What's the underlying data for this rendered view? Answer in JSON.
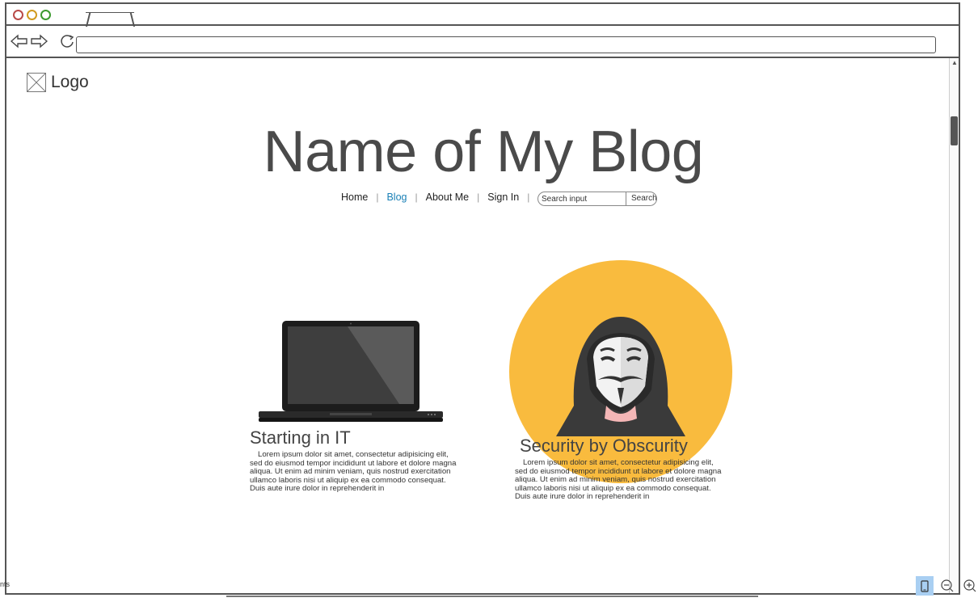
{
  "browser": {
    "url": ""
  },
  "page": {
    "logo_label": "Logo",
    "blog_title": "Name of My Blog",
    "nav": [
      {
        "label": "Home",
        "active": false
      },
      {
        "label": "Blog",
        "active": true
      },
      {
        "label": "About Me",
        "active": false
      },
      {
        "label": "Sign In",
        "active": false
      }
    ],
    "search": {
      "placeholder": "Search input",
      "button_label": "Search"
    },
    "posts": [
      {
        "title": "Starting in IT",
        "image_icon": "laptop-icon",
        "body": "Lorem ipsum dolor sit amet, consectetur adipisicing elit, sed do eiusmod tempor incididunt ut labore et dolore magna aliqua. Ut enim ad minim veniam, quis nostrud exercitation ullamco laboris nisi ut aliquip ex ea commodo consequat. Duis aute irure dolor in reprehenderit in"
      },
      {
        "title": "Security by Obscurity",
        "image_icon": "hacker-mask-icon",
        "body": "Lorem ipsum dolor sit amet, consectetur adipisicing elit, sed do eiusmod tempor incididunt ut labore et dolore magna aliqua. Ut enim ad minim veniam, quis nostrud exercitation ullamco laboris nisi ut aliquip ex ea commodo consequat. Duis aute irure dolor in reprehenderit in"
      }
    ]
  },
  "status": {
    "left_text": "nts"
  },
  "colors": {
    "accent_link": "#1a80b6",
    "hacker_bg": "#f9bb3e"
  }
}
